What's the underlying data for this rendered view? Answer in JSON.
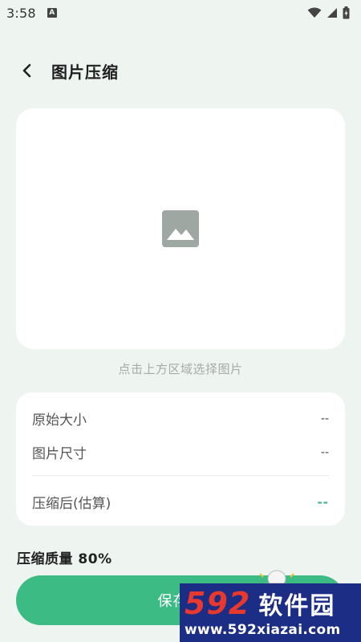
{
  "status_bar": {
    "time": "3:58",
    "notification_badge": "A",
    "icons": [
      "wifi-icon",
      "signal-icon",
      "battery-icon"
    ]
  },
  "header": {
    "title": "图片压缩",
    "back_icon": "chevron-left-icon"
  },
  "picker": {
    "icon": "image-placeholder-icon",
    "hint": "点击上方区域选择图片"
  },
  "info": {
    "original_size_label": "原始大小",
    "original_size_value": "--",
    "dimensions_label": "图片尺寸",
    "dimensions_value": "--",
    "compressed_label": "压缩后(估算)",
    "compressed_value": "--"
  },
  "quality": {
    "label": "压缩质量 80%"
  },
  "save_button": {
    "label": "保存到"
  },
  "watermark": {
    "number": "592",
    "brand": "软件园",
    "url": "www.592xiazai.com"
  },
  "colors": {
    "background": "#eef4f0",
    "accent": "#3dbb85",
    "accent_text": "#3bb287",
    "card": "#ffffff",
    "watermark_bg": "#1b2d84",
    "watermark_red": "#e8392f"
  }
}
